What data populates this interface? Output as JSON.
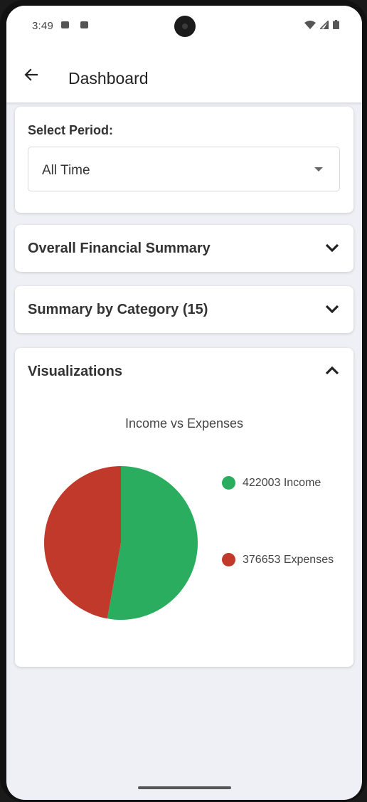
{
  "status_bar": {
    "time": "3:49"
  },
  "app_bar": {
    "title": "Dashboard",
    "back_icon": "arrow-left-icon"
  },
  "period": {
    "label": "Select Period:",
    "selected": "All Time"
  },
  "sections": {
    "overall": {
      "title": "Overall Financial Summary",
      "expanded": false
    },
    "category": {
      "title": "Summary by Category (15)",
      "expanded": false
    },
    "visualizations": {
      "title": "Visualizations",
      "expanded": true
    }
  },
  "chart": {
    "title": "Income vs Expenses",
    "legend": [
      {
        "label": "422003 Income",
        "color": "#2aad5e"
      },
      {
        "label": "376653 Expenses",
        "color": "#c0392b"
      }
    ]
  },
  "chart_data": {
    "type": "pie",
    "title": "Income vs Expenses",
    "categories": [
      "Income",
      "Expenses"
    ],
    "values": [
      422003,
      376653
    ],
    "colors": [
      "#2aad5e",
      "#c0392b"
    ],
    "legend_position": "right"
  }
}
